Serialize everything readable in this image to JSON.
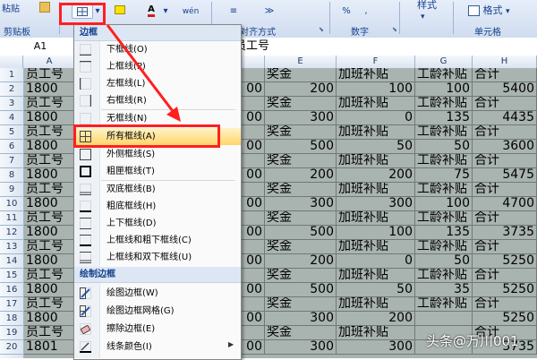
{
  "ribbon": {
    "paste_label": "粘贴",
    "clipboard_label": "剪贴板",
    "font_color_letter": "A",
    "alignment_label": "对齐方式",
    "number_label": "数字",
    "style_label": "样式",
    "format_label": "格式",
    "cells_label": "单元格"
  },
  "formula_bar": {
    "name_box": "A1",
    "formula": "员工号"
  },
  "sheet": {
    "columns": [
      "A",
      "B",
      "C",
      "D",
      "E",
      "F",
      "G",
      "H"
    ],
    "rows": [
      "1",
      "2",
      "3",
      "4",
      "5",
      "6",
      "7",
      "8",
      "9",
      "10",
      "11",
      "12",
      "13",
      "14",
      "15",
      "16",
      "17",
      "18",
      "19",
      "20"
    ],
    "data": [
      [
        "员工号",
        "",
        "",
        "资",
        "奖金",
        "加班补贴",
        "工龄补贴",
        "合计"
      ],
      [
        "1800",
        "",
        "",
        "00",
        "200",
        "100",
        "100",
        "5400"
      ],
      [
        "员工号",
        "",
        "",
        "资",
        "奖金",
        "加班补贴",
        "工龄补贴",
        "合计"
      ],
      [
        "1800",
        "",
        "",
        "00",
        "300",
        "0",
        "135",
        "4435"
      ],
      [
        "员工号",
        "",
        "",
        "资",
        "奖金",
        "加班补贴",
        "工龄补贴",
        "合计"
      ],
      [
        "1800",
        "",
        "",
        "00",
        "500",
        "50",
        "50",
        "3600"
      ],
      [
        "员工号",
        "",
        "",
        "资",
        "奖金",
        "加班补贴",
        "工龄补贴",
        "合计"
      ],
      [
        "1800",
        "",
        "",
        "00",
        "200",
        "200",
        "75",
        "5475"
      ],
      [
        "员工号",
        "",
        "",
        "资",
        "奖金",
        "加班补贴",
        "工龄补贴",
        "合计"
      ],
      [
        "1800",
        "",
        "",
        "00",
        "300",
        "300",
        "100",
        "4700"
      ],
      [
        "员工号",
        "",
        "",
        "资",
        "奖金",
        "加班补贴",
        "工龄补贴",
        "合计"
      ],
      [
        "1800",
        "",
        "",
        "00",
        "500",
        "100",
        "135",
        "3735"
      ],
      [
        "员工号",
        "",
        "",
        "资",
        "奖金",
        "加班补贴",
        "工龄补贴",
        "合计"
      ],
      [
        "1800",
        "",
        "",
        "00",
        "200",
        "0",
        "50",
        "5250"
      ],
      [
        "员工号",
        "",
        "",
        "资",
        "奖金",
        "加班补贴",
        "工龄补贴",
        "合计"
      ],
      [
        "1800",
        "",
        "",
        "00",
        "500",
        "50",
        "35",
        "5250"
      ],
      [
        "员工号",
        "",
        "",
        "资",
        "奖金",
        "加班补贴",
        "工龄补贴",
        "合计"
      ],
      [
        "1800",
        "",
        "",
        "00",
        "300",
        "200",
        "",
        "5250"
      ],
      [
        "员工号",
        "",
        "",
        "资",
        "奖金",
        "加班补贴",
        "",
        "合计"
      ],
      [
        "1801",
        "",
        "",
        "00",
        "300",
        "300",
        "",
        "3735"
      ]
    ]
  },
  "border_menu": {
    "header": "边框",
    "draw_header": "绘制边框",
    "items": [
      {
        "label": "下框线(O)",
        "icon": "border-bottom-icon"
      },
      {
        "label": "上框线(P)",
        "icon": "border-top-icon"
      },
      {
        "label": "左框线(L)",
        "icon": "border-left-icon"
      },
      {
        "label": "右框线(R)",
        "icon": "border-right-icon"
      },
      {
        "label": "无框线(N)",
        "icon": "border-none-icon"
      },
      {
        "label": "所有框线(A)",
        "icon": "border-all-icon"
      },
      {
        "label": "外侧框线(S)",
        "icon": "border-outside-icon"
      },
      {
        "label": "粗匣框线(T)",
        "icon": "border-thick-box-icon"
      },
      {
        "label": "双底框线(B)",
        "icon": "border-double-bottom-icon"
      },
      {
        "label": "粗底框线(H)",
        "icon": "border-thick-bottom-icon"
      },
      {
        "label": "上下框线(D)",
        "icon": "border-top-bottom-icon"
      },
      {
        "label": "上框线和粗下框线(C)",
        "icon": "border-top-thick-bottom-icon"
      },
      {
        "label": "上框线和双下框线(U)",
        "icon": "border-top-double-bottom-icon"
      }
    ],
    "draw_items": [
      {
        "label": "绘图边框(W)",
        "icon": "draw-border-icon"
      },
      {
        "label": "绘图边框网格(G)",
        "icon": "draw-border-grid-icon"
      },
      {
        "label": "擦除边框(E)",
        "icon": "eraser-icon"
      },
      {
        "label": "线条颜色(I)",
        "icon": "line-color-icon"
      }
    ]
  },
  "watermark": "头条@万川001",
  "colors": {
    "highlight": "#ffd66b",
    "red_annotation": "#ff1f1f",
    "cell_fill": "#a9b3af"
  }
}
